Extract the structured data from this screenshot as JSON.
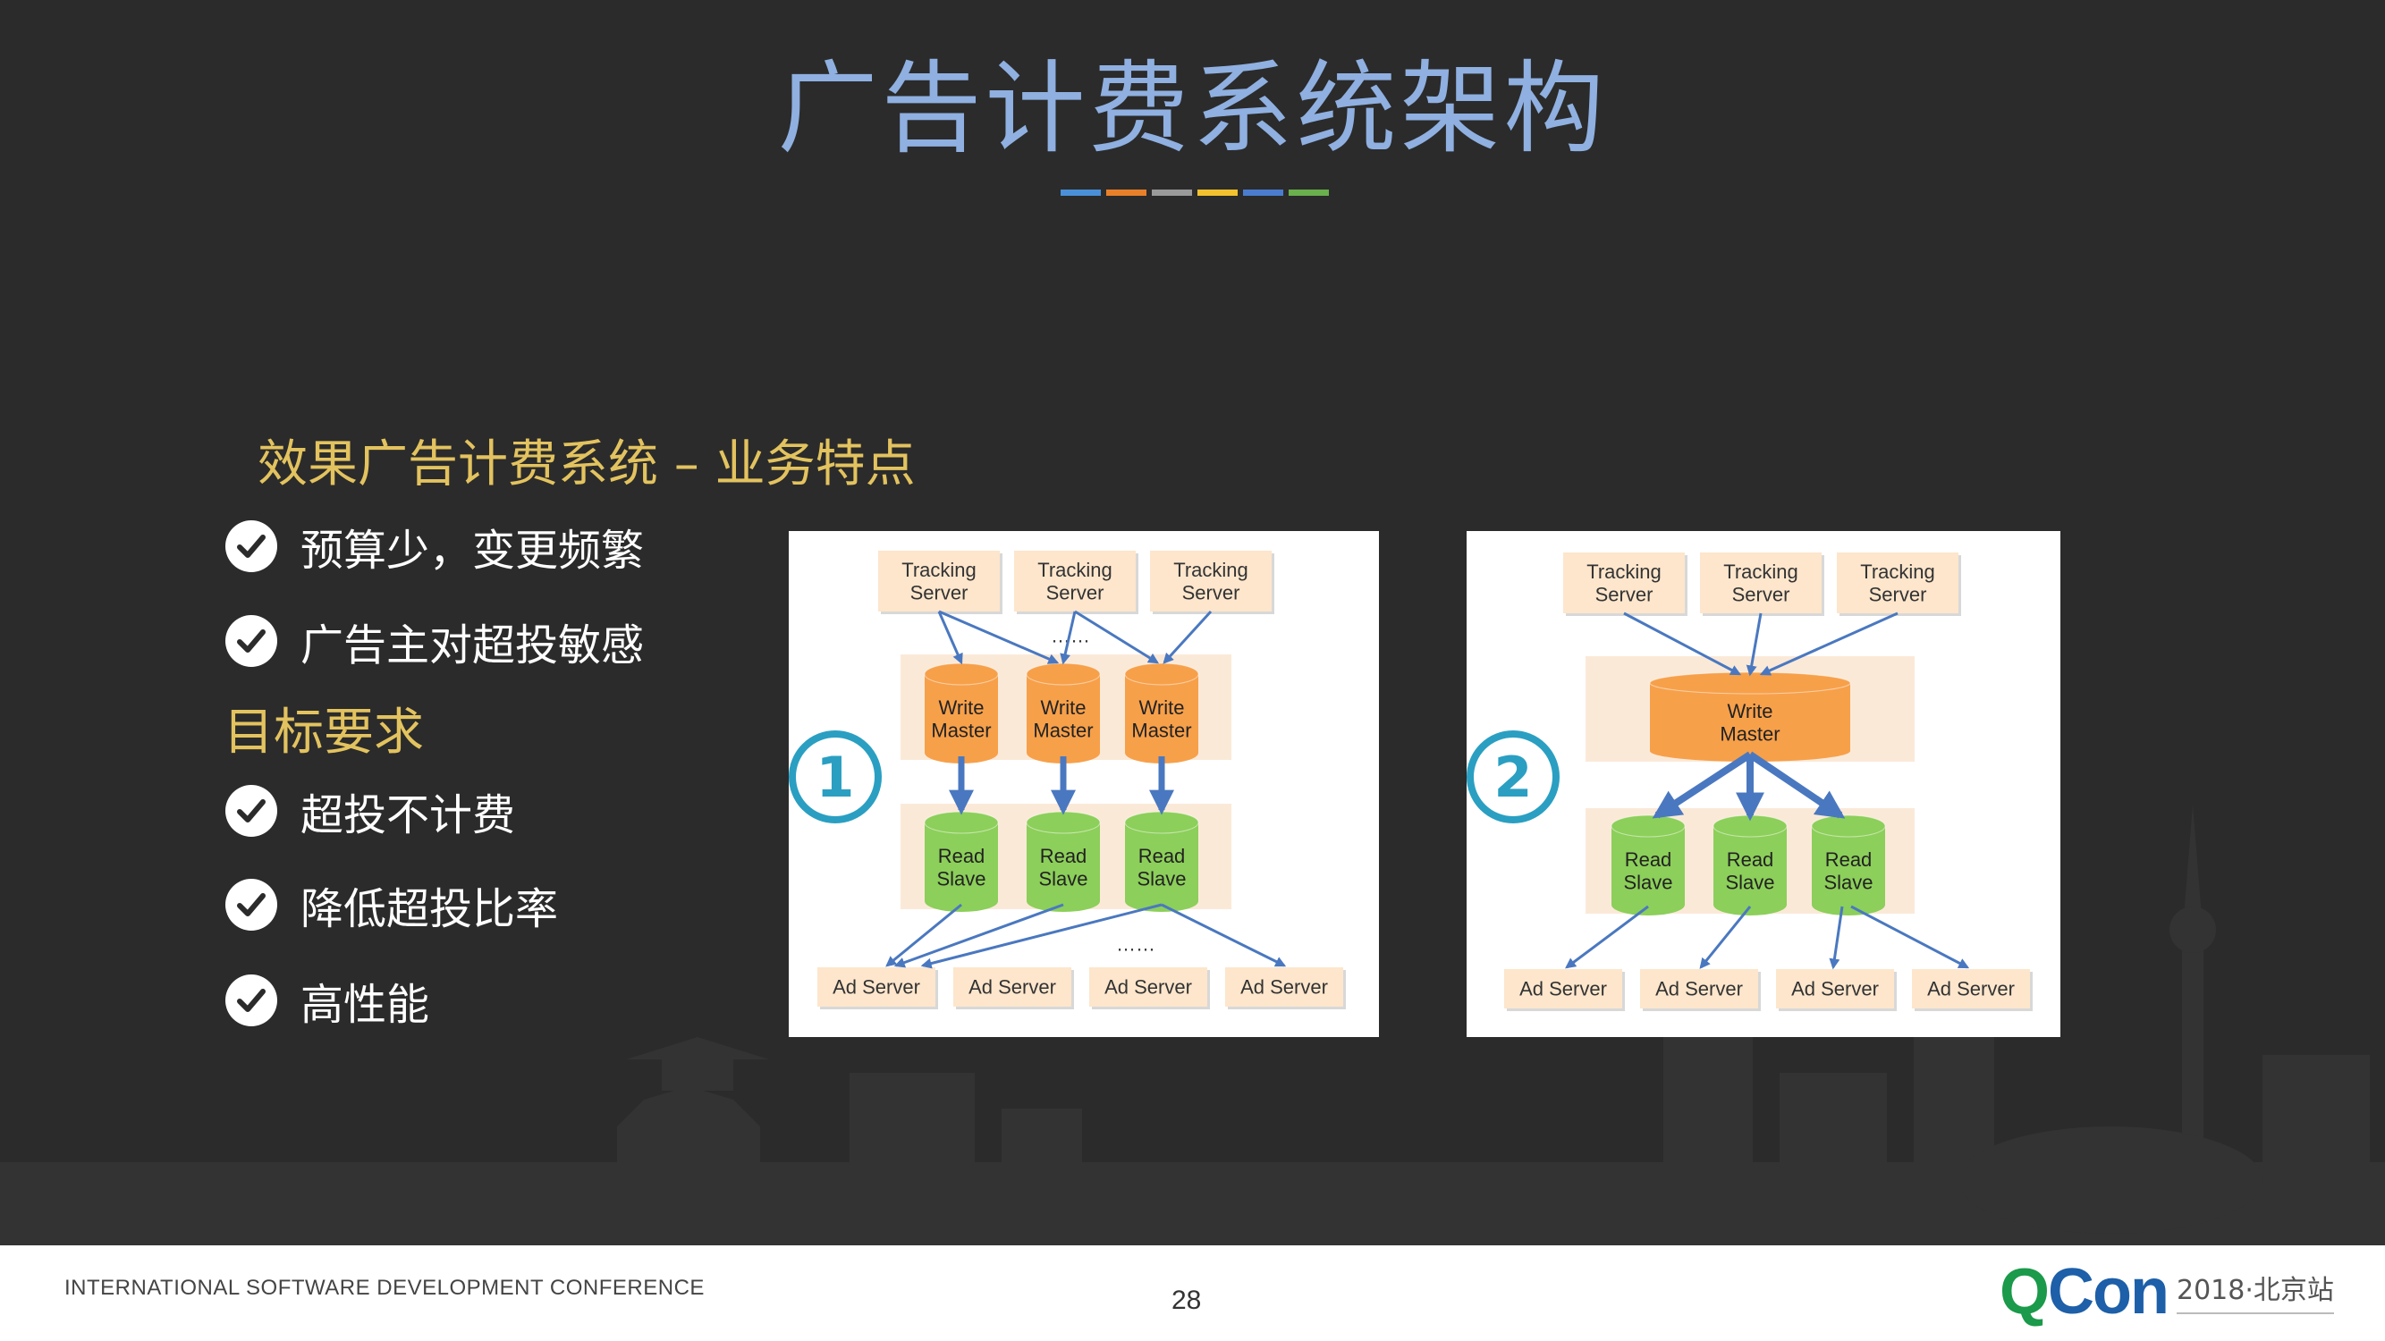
{
  "slide": {
    "title": "广告计费系统架构",
    "title_bar_colors": [
      "#4a90d9",
      "#e8802a",
      "#9a9a9a",
      "#f2c12e",
      "#4a7dd0",
      "#6ab04c"
    ],
    "section1_heading": "效果广告计费系统 – 业务特点",
    "section1_items": [
      "预算少，变更频繁",
      "广告主对超投敏感"
    ],
    "section2_heading": "目标要求",
    "section2_items": [
      "超投不计费",
      "降低超投比率",
      "高性能"
    ],
    "check_icon": "check-circle-icon"
  },
  "diagram1": {
    "number": "1",
    "tracking_servers": [
      "Tracking\nServer",
      "Tracking\nServer",
      "Tracking\nServer"
    ],
    "write_masters": [
      "Write\nMaster",
      "Write\nMaster",
      "Write\nMaster"
    ],
    "read_slaves": [
      "Read\nSlave",
      "Read\nSlave",
      "Read\nSlave"
    ],
    "ad_servers": [
      "Ad Server",
      "Ad Server",
      "Ad Server",
      "Ad Server"
    ],
    "ellipsis": "……"
  },
  "diagram2": {
    "number": "2",
    "tracking_servers": [
      "Tracking\nServer",
      "Tracking\nServer",
      "Tracking\nServer"
    ],
    "write_master": "Write\nMaster",
    "read_slaves": [
      "Read\nSlave",
      "Read\nSlave",
      "Read\nSlave"
    ],
    "ad_servers": [
      "Ad Server",
      "Ad Server",
      "Ad Server",
      "Ad Server"
    ]
  },
  "footer": {
    "conference": "INTERNATIONAL SOFTWARE DEVELOPMENT CONFERENCE",
    "page_number": "28",
    "logo_q": "Q",
    "logo_con": "Con",
    "edition": "2018·北京站"
  },
  "colors": {
    "slide_bg": "#2b2b2b",
    "title": "#8fb0e0",
    "heading": "#e3c35f",
    "write_master": "#f7a04a",
    "read_slave": "#8ccf5a",
    "server_box": "#fde6cc",
    "arrow": "#4a78c0"
  }
}
